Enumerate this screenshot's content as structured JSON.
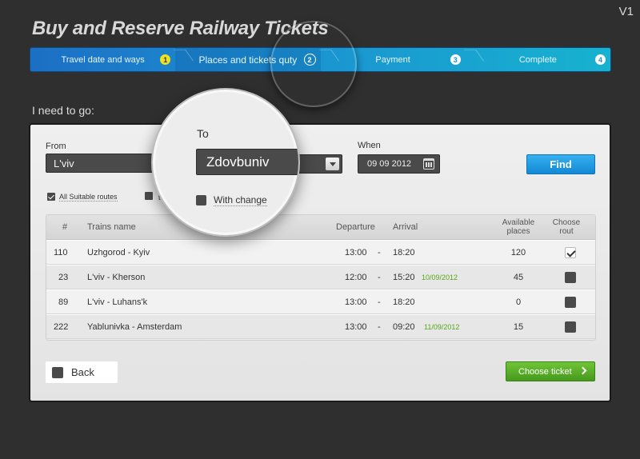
{
  "version": "V1",
  "title": "Buy and Reserve Railway Tickets",
  "steps": [
    {
      "label": "Travel date and ways",
      "num": "1"
    },
    {
      "label": "Places and tickets quty",
      "num": "2"
    },
    {
      "label": "Payment",
      "num": "3"
    },
    {
      "label": "Complete",
      "num": "4"
    }
  ],
  "prompt": "I need to go:",
  "form": {
    "from_label": "From",
    "from_value": "L'viv",
    "to_label": "To",
    "to_value": "Zdovbuniv",
    "when_label": "When",
    "when_value": "09 09 2012",
    "find_label": "Find",
    "all_routes_label": "All Suitable routes",
    "partial_label": "t",
    "with_change_label": "With change"
  },
  "table": {
    "headers": {
      "num": "#",
      "name": "Trains name",
      "departure": "Departure",
      "arrival": "Arrival",
      "places": "Available places",
      "choose": "Choose rout"
    },
    "rows": [
      {
        "num": "110",
        "name": "Uzhgorod - Kyiv",
        "dep": "13:00",
        "sep": "-",
        "arr": "18:20",
        "arr_date": "",
        "places": "120",
        "checked": true
      },
      {
        "num": "23",
        "name": "L'viv - Kherson",
        "dep": "12:00",
        "sep": "-",
        "arr": "15:20",
        "arr_date": "10/09/2012",
        "places": "45",
        "checked": false
      },
      {
        "num": "89",
        "name": "L'viv - Luhans'k",
        "dep": "13:00",
        "sep": "-",
        "arr": "18:20",
        "arr_date": "",
        "places": "0",
        "checked": false
      },
      {
        "num": "222",
        "name": "Yablunivka - Amsterdam",
        "dep": "13:00",
        "sep": "-",
        "arr": "09:20",
        "arr_date": "11/09/2012",
        "places": "15",
        "checked": false
      }
    ]
  },
  "back_label": "Back",
  "choose_ticket_label": "Choose ticket"
}
